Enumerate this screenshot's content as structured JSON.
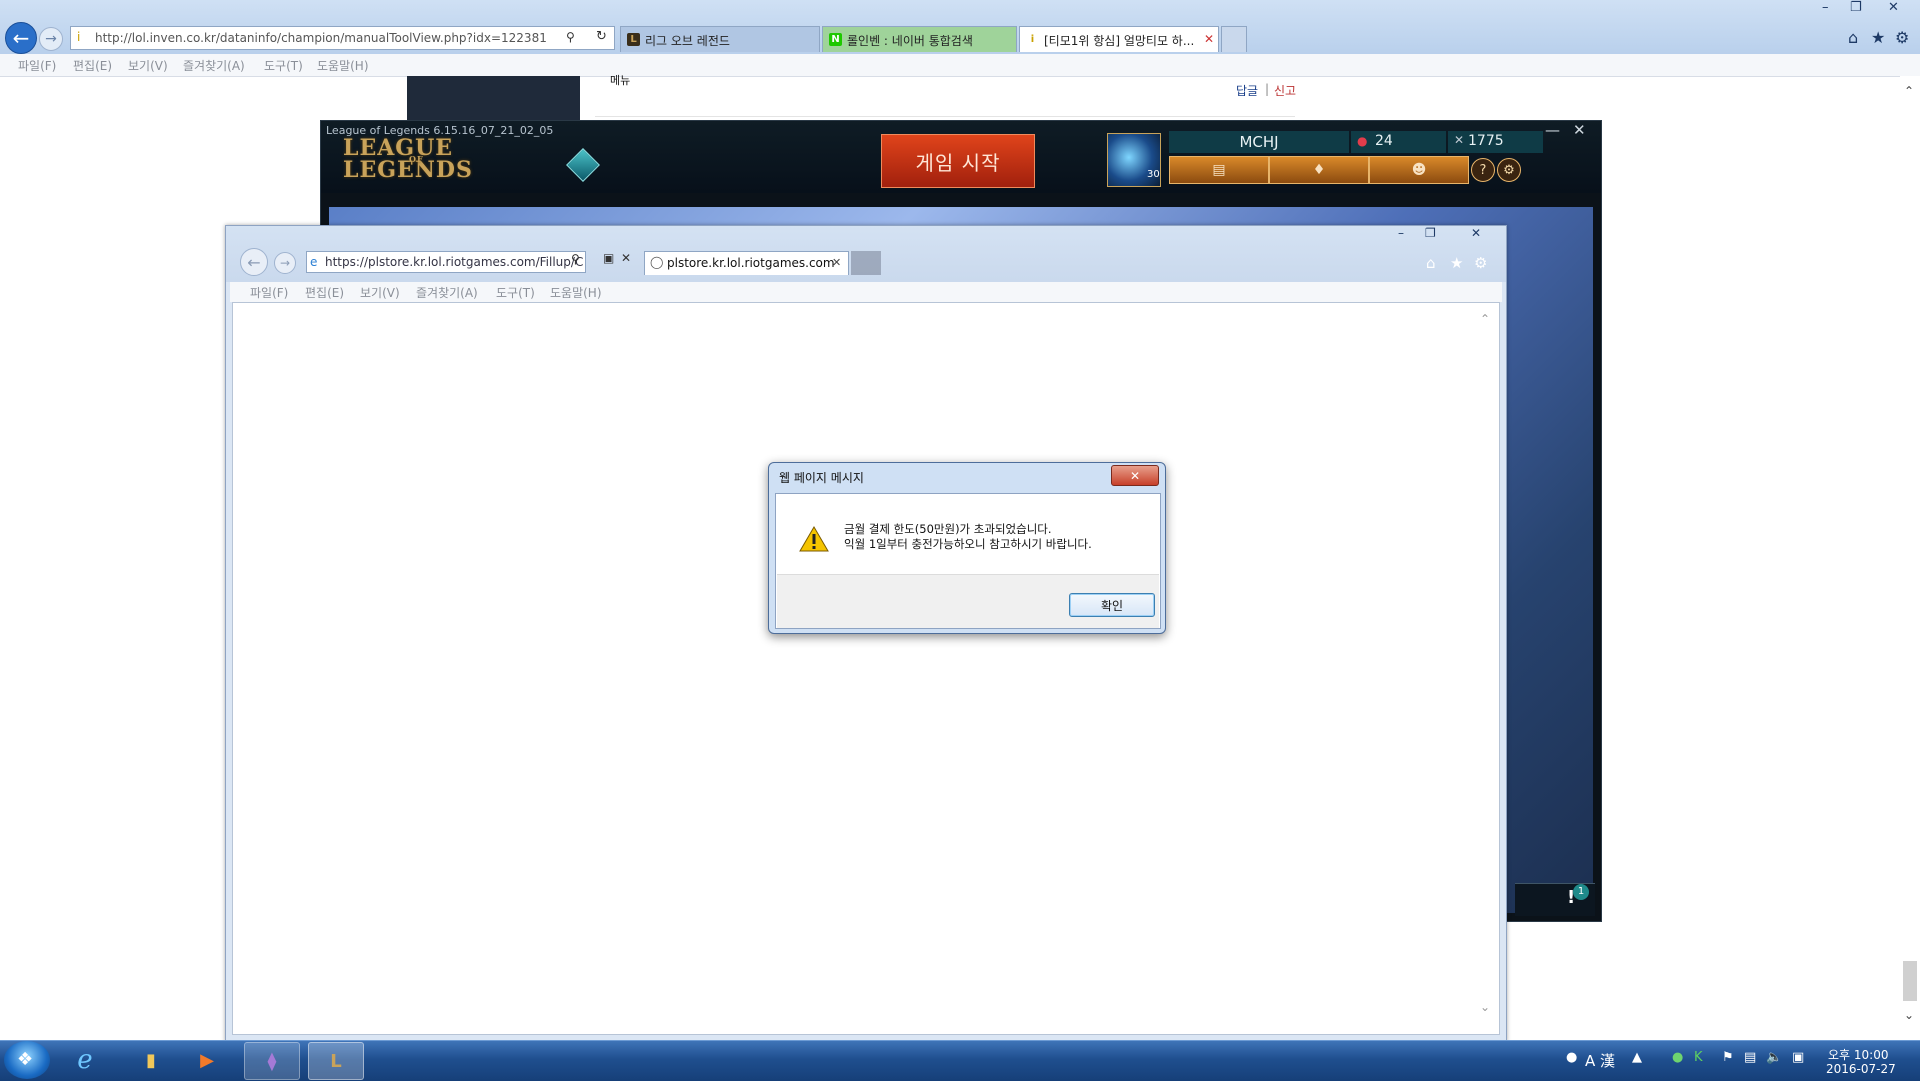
{
  "outer_browser": {
    "address": "http://lol.inven.co.kr/dataninfo/champion/manualToolView.php?idx=122381",
    "tabs": [
      {
        "label": "리그 오브 레전드",
        "color": "#b0c6e3"
      },
      {
        "label": "롤인벤 : 네이버 통합검색",
        "color": "#9fd39a"
      },
      {
        "label": "[티모1위 항심] 얼망티모 하...",
        "color": "#ffffff"
      }
    ],
    "tab_close": "✕",
    "menu": [
      "파일(F)",
      "편집(E)",
      "보기(V)",
      "즐겨찾기(A)",
      "도구(T)",
      "도움말(H)"
    ],
    "window_controls": [
      "–",
      "❐",
      "✕"
    ],
    "right_icons": [
      "⌂",
      "★",
      "⚙"
    ]
  },
  "background_page": {
    "link_text": "메뉴",
    "reply_text": "답글",
    "separator": "|",
    "report_text": "신고"
  },
  "lol_client": {
    "version": "League of Legends 6.15.16_07_21_02_05",
    "logo_line1": "LEAGUE",
    "logo_of": "OF",
    "logo_line2": "LEGENDS",
    "play_button": "게임 시작",
    "summoner_name": "MCHJ",
    "level": "30",
    "rp": "24",
    "ip": "1775",
    "window_controls": [
      "—",
      "✕"
    ],
    "alert_icon": "!",
    "alert_badge": "1"
  },
  "inner_browser": {
    "address": "https://plstore.kr.lol.riotgames.com/Fillup/C",
    "tab_label": "plstore.kr.lol.riotgames.com",
    "menu": [
      "파일(F)",
      "편집(E)",
      "보기(V)",
      "즐겨찾기(A)",
      "도구(T)",
      "도움말(H)"
    ],
    "window_controls": [
      "–",
      "❐",
      "✕"
    ],
    "right_icons": [
      "⌂",
      "★",
      "⚙"
    ]
  },
  "dialog": {
    "title": "웹 페이지 메시지",
    "line1": "금월 결제 한도(50만원)가 초과되었습니다.",
    "line2": "익월 1일부터 충전가능하오니 참고하시기 바랍니다.",
    "ok_label": "확인",
    "close_label": "✕"
  },
  "taskbar": {
    "apps": [
      "internet-explorer",
      "file-explorer",
      "media-player",
      "visual-studio",
      "league-of-legends"
    ],
    "time": "오후 10:00",
    "date": "2016-07-27",
    "ime": "A 漢"
  },
  "colors": {
    "accent": "#2a6fc9",
    "play_button": "#c7301a",
    "lol_gold": "#c9a35a"
  }
}
